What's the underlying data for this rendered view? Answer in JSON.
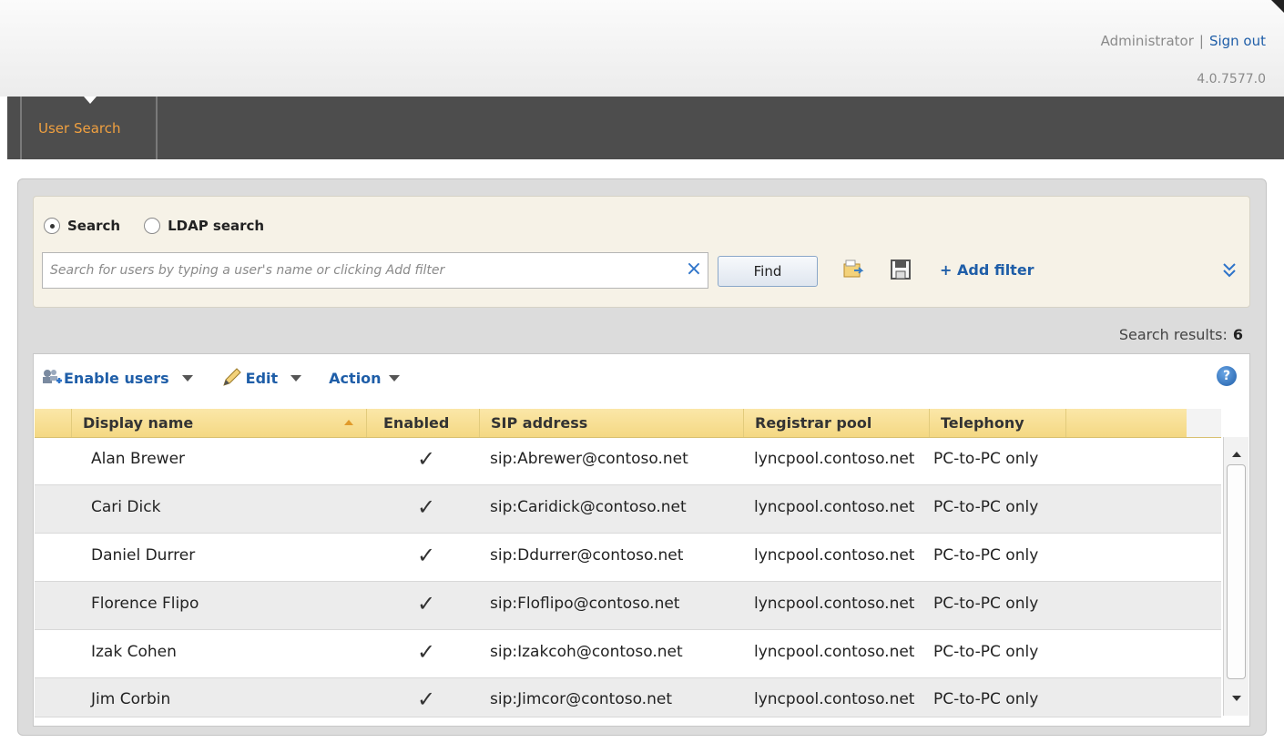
{
  "header": {
    "user": "Administrator",
    "separator": "|",
    "sign_out": "Sign out",
    "version": "4.0.7577.0"
  },
  "nav": {
    "tabs": [
      {
        "label": "User Search",
        "active": true
      }
    ]
  },
  "search": {
    "mode_search": "Search",
    "mode_ldap": "LDAP search",
    "selected_mode": "Search",
    "placeholder": "Search for users by typing a user's name or clicking Add filter",
    "value": "",
    "find_label": "Find",
    "add_filter_label": "+ Add filter"
  },
  "results": {
    "label": "Search results:",
    "count": "6"
  },
  "toolbar": {
    "enable_users": "Enable users",
    "edit": "Edit",
    "action": "Action",
    "help": "?"
  },
  "grid": {
    "columns": [
      "Display name",
      "Enabled",
      "SIP address",
      "Registrar pool",
      "Telephony"
    ],
    "sorted_by": "Display name",
    "rows": [
      {
        "name": "Alan Brewer",
        "enabled": "✓",
        "sip": "sip:Abrewer@contoso.net",
        "pool": "lyncpool.contoso.net",
        "telephony": "PC-to-PC only"
      },
      {
        "name": "Cari Dick",
        "enabled": "✓",
        "sip": "sip:Caridick@contoso.net",
        "pool": "lyncpool.contoso.net",
        "telephony": "PC-to-PC only"
      },
      {
        "name": "Daniel Durrer",
        "enabled": "✓",
        "sip": "sip:Ddurrer@contoso.net",
        "pool": "lyncpool.contoso.net",
        "telephony": "PC-to-PC only"
      },
      {
        "name": "Florence Flipo",
        "enabled": "✓",
        "sip": "sip:Floflipo@contoso.net",
        "pool": "lyncpool.contoso.net",
        "telephony": "PC-to-PC only"
      },
      {
        "name": "Izak Cohen",
        "enabled": "✓",
        "sip": "sip:Izakcoh@contoso.net",
        "pool": "lyncpool.contoso.net",
        "telephony": "PC-to-PC only"
      },
      {
        "name": "Jim Corbin",
        "enabled": "✓",
        "sip": "sip:Jimcor@contoso.net",
        "pool": "lyncpool.contoso.net",
        "telephony": "PC-to-PC only"
      }
    ]
  },
  "colors": {
    "accent_orange": "#f0a040",
    "link_blue": "#1f5ea8",
    "header_gold": "#f4d883",
    "nav_dark": "#4d4d4d"
  }
}
